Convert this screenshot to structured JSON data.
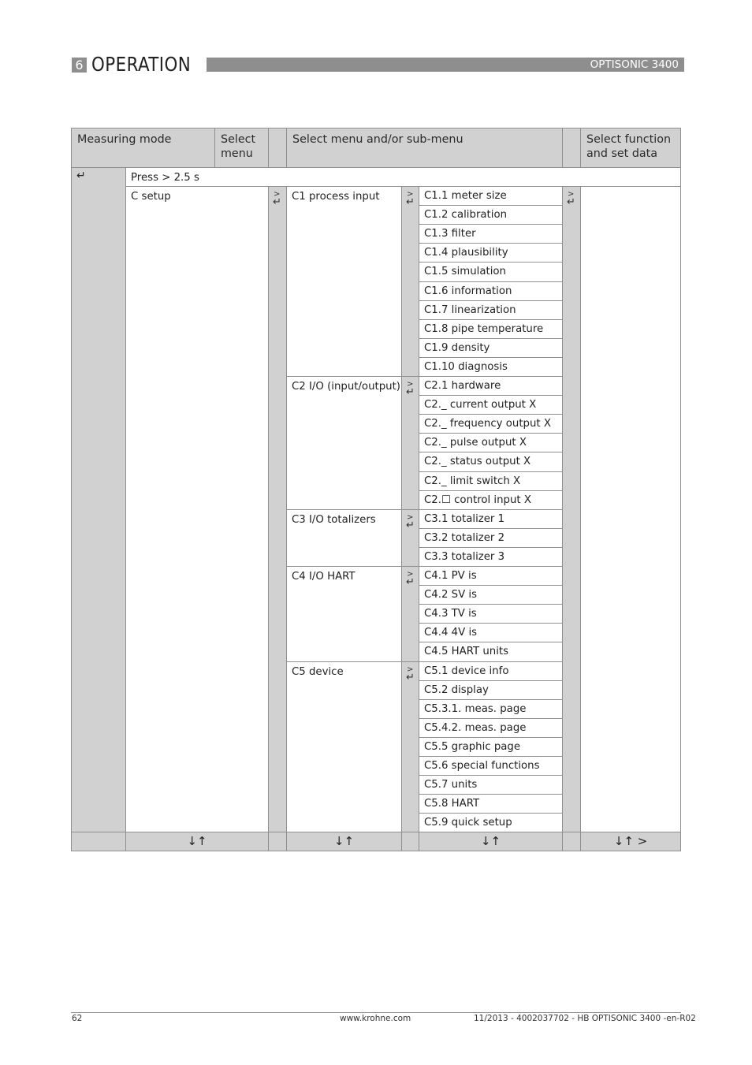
{
  "header": {
    "chapter_number": "6",
    "chapter_title": "OPERATION",
    "product": "OPTISONIC 3400"
  },
  "table": {
    "headers": {
      "measuring_mode": "Measuring mode",
      "select_menu": "Select menu",
      "select_submenu": "Select menu and/or sub-menu",
      "select_function": "Select function and set data"
    },
    "enter_symbol": "↵",
    "press_text": "Press > 2.5 s",
    "main_menu": "C setup",
    "next_symbol": ">",
    "groups": [
      {
        "label": "C1 process input",
        "items": [
          "C1.1 meter size",
          "C1.2 calibration",
          "C1.3 filter",
          "C1.4 plausibility",
          "C1.5 simulation",
          "C1.6 information",
          "C1.7 linearization",
          "C1.8 pipe temperature",
          "C1.9 density",
          "C1.10 diagnosis"
        ]
      },
      {
        "label": "C2 I/O (input/output)",
        "items": [
          "C2.1 hardware",
          "C2._ current output X",
          "C2._ frequency output X",
          "C2._ pulse output X",
          "C2._ status output X",
          "C2._ limit switch X",
          "C2.☐ control input X"
        ]
      },
      {
        "label": "C3 I/O totalizers",
        "items": [
          "C3.1 totalizer 1",
          "C3.2 totalizer 2",
          "C3.3 totalizer 3"
        ]
      },
      {
        "label": "C4 I/O HART",
        "items": [
          "C4.1 PV is",
          "C4.2 SV is",
          "C4.3 TV is",
          "C4.4 4V is",
          "C4.5 HART units"
        ]
      },
      {
        "label": "C5 device",
        "items": [
          "C5.1 device info",
          "C5.2 display",
          "C5.3.1. meas. page",
          "C5.4.2. meas. page",
          "C5.5 graphic page",
          "C5.6 special functions",
          "C5.7 units",
          "C5.8 HART",
          "C5.9 quick setup"
        ]
      }
    ],
    "nav_row": {
      "menu": "↓↑",
      "submenu": "↓↑",
      "item": "↓↑",
      "function": "↓↑ >"
    }
  },
  "footer": {
    "page_number": "62",
    "website": "www.krohne.com",
    "doc_ref": "11/2013 - 4002037702 - HB OPTISONIC 3400 -en-R02"
  }
}
